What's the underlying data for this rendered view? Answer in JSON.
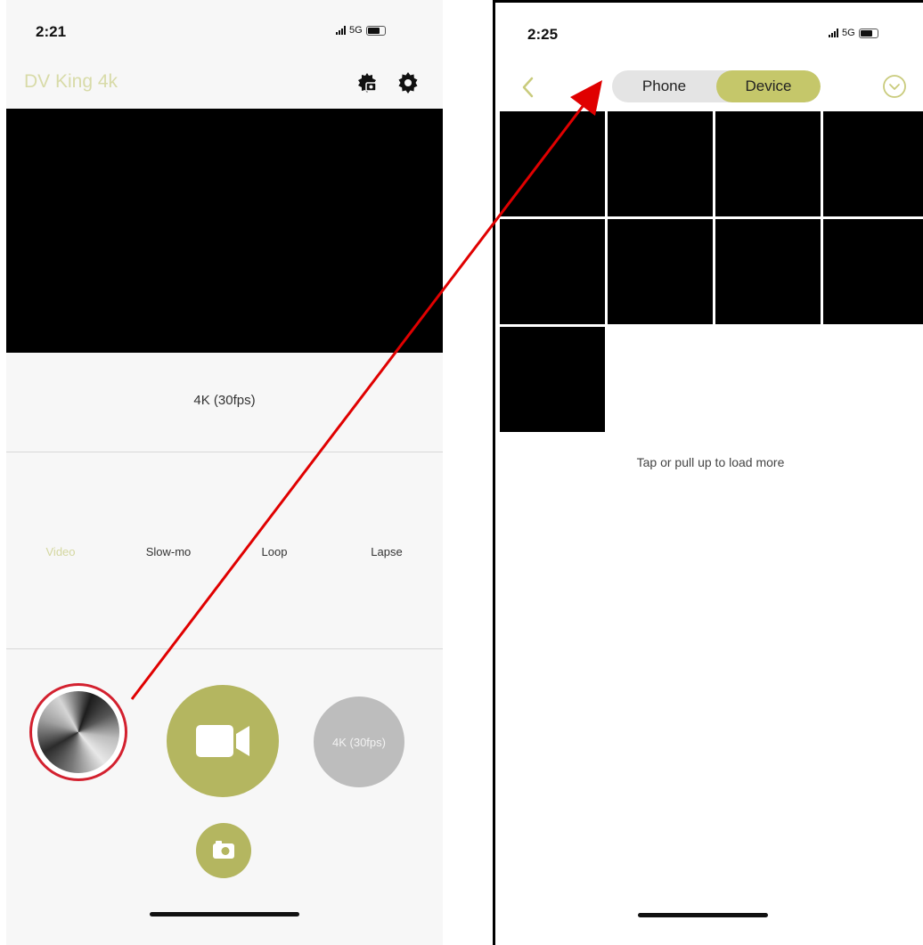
{
  "left_screen": {
    "status_time": "2:21",
    "network": "5G",
    "app_title": "DV King 4k",
    "resolution_label": "4K (30fps)",
    "modes": [
      {
        "label": "Video",
        "active": true
      },
      {
        "label": "Slow-mo",
        "active": false
      },
      {
        "label": "Loop",
        "active": false
      },
      {
        "label": "Lapse",
        "active": false
      }
    ],
    "resolution_button_label": "4K (30fps)",
    "icons": {
      "gallery": "gallery-thumbnail",
      "record": "video-camera-icon",
      "snapshot": "camera-icon",
      "header_left": "camera-settings-icon",
      "header_right": "gear-icon"
    }
  },
  "right_screen": {
    "status_time": "2:25",
    "network": "5G",
    "tabs": [
      {
        "label": "Phone",
        "selected": false
      },
      {
        "label": "Device",
        "selected": true
      }
    ],
    "load_more_text": "Tap or pull up to load more",
    "thumbnail_count": 9
  },
  "colors": {
    "accent": "#b4b660",
    "accent_light": "#d4d7a0",
    "highlight_red": "#d3212f",
    "arrow_red": "#e00000"
  }
}
